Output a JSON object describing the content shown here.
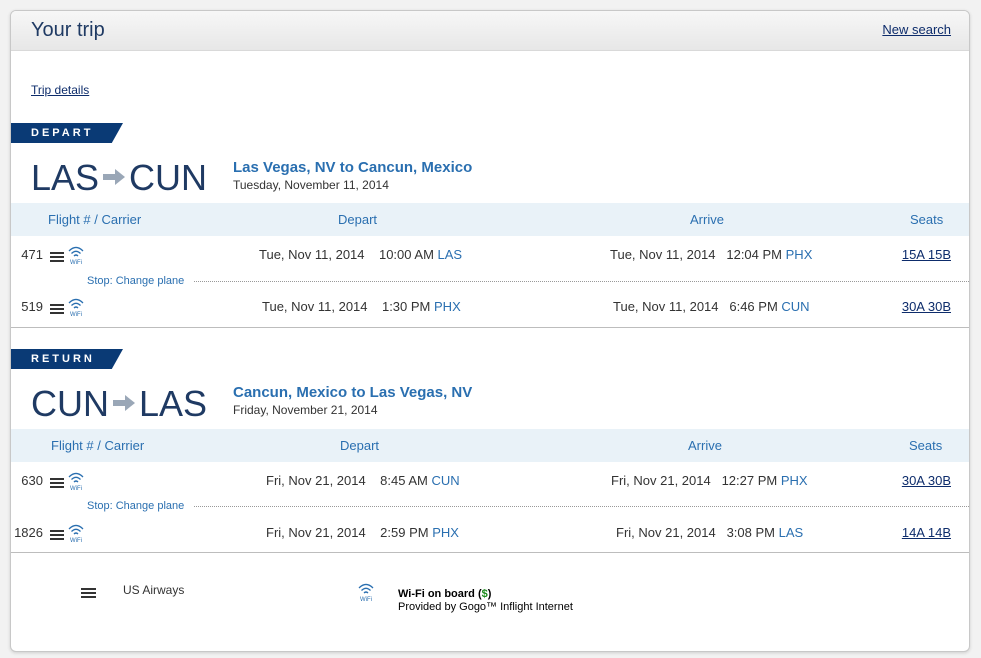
{
  "header": {
    "title": "Your trip",
    "new_search": "New search"
  },
  "trip_details": "Trip details",
  "depart": {
    "badge": "DEPART",
    "from": "LAS",
    "to": "CUN",
    "title": "Las Vegas, NV to Cancun, Mexico",
    "date": "Tuesday, November 11, 2014",
    "columns": {
      "flight": "Flight # / Carrier",
      "depart": "Depart",
      "arrive": "Arrive",
      "seats": "Seats"
    },
    "flights": [
      {
        "number": "471",
        "dep_date": "Tue, Nov 11, 2014",
        "dep_time": "10:00 AM",
        "dep_city": "LAS",
        "arr_date": "Tue, Nov 11, 2014",
        "arr_time": "12:04 PM",
        "arr_city": "PHX",
        "seats": "15A 15B"
      },
      {
        "number": "519",
        "dep_date": "Tue, Nov 11, 2014",
        "dep_time": "1:30 PM",
        "dep_city": "PHX",
        "arr_date": "Tue, Nov 11, 2014",
        "arr_time": "6:46 PM",
        "arr_city": "CUN",
        "seats": "30A 30B"
      }
    ],
    "stop": "Stop: Change plane"
  },
  "return": {
    "badge": "RETURN",
    "from": "CUN",
    "to": "LAS",
    "title": "Cancun, Mexico to Las Vegas, NV",
    "date": "Friday, November 21, 2014",
    "columns": {
      "flight": "Flight # / Carrier",
      "depart": "Depart",
      "arrive": "Arrive",
      "seats": "Seats"
    },
    "flights": [
      {
        "number": "630",
        "dep_date": "Fri, Nov 21, 2014",
        "dep_time": "8:45 AM",
        "dep_city": "CUN",
        "arr_date": "Fri, Nov 21, 2014",
        "arr_time": "12:27 PM",
        "arr_city": "PHX",
        "seats": "30A 30B"
      },
      {
        "number": "1826",
        "dep_date": "Fri, Nov 21, 2014",
        "dep_time": "2:59 PM",
        "dep_city": "PHX",
        "arr_date": "Fri, Nov 21, 2014",
        "arr_time": "3:08 PM",
        "arr_city": "LAS",
        "seats": "14A 14B"
      }
    ],
    "stop": "Stop: Change plane"
  },
  "legend": {
    "airline": "US Airways",
    "wifi_title": "Wi-Fi on board",
    "wifi_price_open": "(",
    "wifi_price_symbol": "$",
    "wifi_price_close": ")",
    "wifi_provider": "Provided by Gogo™ Inflight Internet",
    "wifi_icon_text": "WiFi"
  }
}
